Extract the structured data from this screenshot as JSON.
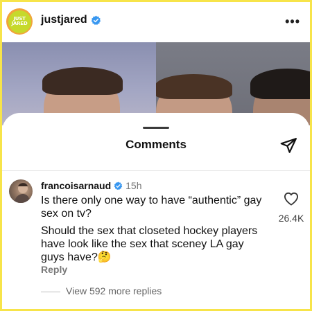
{
  "header": {
    "account_name": "justjared",
    "logo_text_top": "JUST",
    "logo_text_bottom": "JARED",
    "more_icon": "more-horizontal-icon"
  },
  "sheet": {
    "title": "Comments",
    "share_icon": "send-icon"
  },
  "comment": {
    "username": "francoisarnaud",
    "time": "15h",
    "line1": "Is there only one way to have “authentic” gay sex on tv?",
    "line2": "Should the sex that closeted hockey players have look like the sex that sceney LA gay guys have?🤔",
    "reply_label": "Reply",
    "like_count": "26.4K",
    "like_icon": "heart-outline-icon",
    "view_replies": "View 592 more replies"
  },
  "colors": {
    "border": "#f7e44a",
    "verified": "#3897f0",
    "logo_ring": "#f2a33a",
    "logo_fill": "#c6d92b"
  }
}
